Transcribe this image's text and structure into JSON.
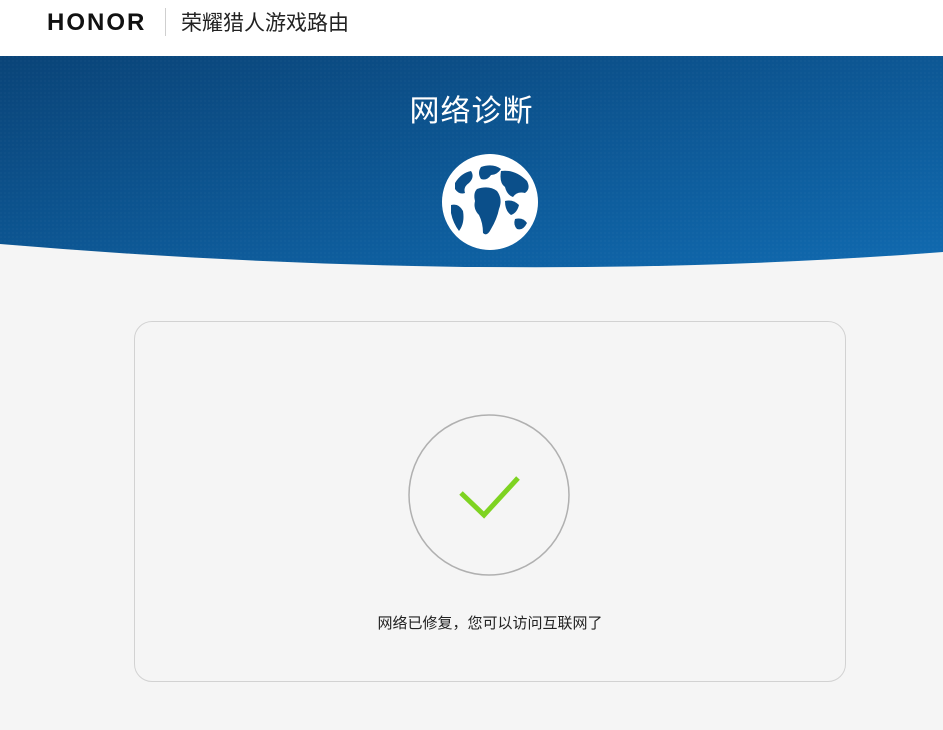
{
  "header": {
    "brand": "HONOR",
    "product_name": "荣耀猎人游戏路由"
  },
  "banner": {
    "title": "网络诊断",
    "icon": "globe-icon"
  },
  "result": {
    "icon": "check-icon",
    "message": "网络已修复，您可以访问互联网了"
  },
  "colors": {
    "banner_dark": "#0b4a82",
    "banner_light": "#0f69a8",
    "check": "#7ed321",
    "background": "#f5f5f5"
  }
}
